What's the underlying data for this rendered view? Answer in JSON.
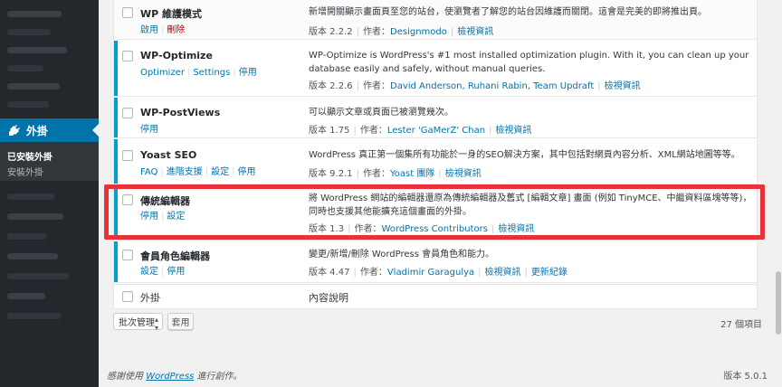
{
  "sidebar": {
    "plugins_menu_label": "外掛",
    "submenu": [
      {
        "label": "已安裝外掛",
        "current": true
      },
      {
        "label": "安裝外掛",
        "current": false
      }
    ]
  },
  "plugins": [
    {
      "name": "WP 維護模式",
      "status": "inactive",
      "actions": [
        {
          "label": "啟用"
        },
        {
          "label": "刪除",
          "danger": true
        }
      ],
      "description": "新增開關顯示畫面頁至您的站台，使瀏覽者了解您的站台因維護而關閉。這會是完美的即將推出頁。",
      "version": "版本 2.2.2",
      "author_prefix": "作者：",
      "authors": "Designmodo",
      "details": "檢視資訊"
    },
    {
      "name": "WP-Optimize",
      "status": "active",
      "actions": [
        {
          "label": "Optimizer"
        },
        {
          "label": "Settings"
        },
        {
          "label": "停用"
        }
      ],
      "description": "WP-Optimize is WordPress's #1 most installed optimization plugin. With it, you can clean up your database easily and safely, without manual queries.",
      "version": "版本 2.2.6",
      "author_prefix": "作者：",
      "authors": "David Anderson, Ruhani Rabin, Team Updraft",
      "details": "檢視資訊"
    },
    {
      "name": "WP-PostViews",
      "status": "active",
      "actions": [
        {
          "label": "停用"
        }
      ],
      "description": "可以顯示文章或頁面已被瀏覽幾次。",
      "version": "版本 1.75",
      "author_prefix": "作者：",
      "authors": "Lester 'GaMerZ' Chan",
      "details": "檢視資訊"
    },
    {
      "name": "Yoast SEO",
      "status": "active",
      "actions": [
        {
          "label": "FAQ"
        },
        {
          "label": "進階支援"
        },
        {
          "label": "設定"
        },
        {
          "label": "停用"
        }
      ],
      "description": "WordPress 真正第一個集所有功能於一身的SEO解決方案，其中包括對網頁內容分析、XML網站地圖等等。",
      "version": "版本 9.2.1",
      "author_prefix": "作者：",
      "authors": "Yoast 團隊",
      "details": "檢視資訊"
    },
    {
      "name": "傳統編輯器",
      "status": "active",
      "actions": [
        {
          "label": "停用"
        },
        {
          "label": "設定"
        }
      ],
      "description": "將 WordPress 網站的編輯器還原為傳統編輯器及舊式 [編輯文章] 畫面 (例如 TinyMCE、中繼資料區塊等等)，同時也支援其他能擴充這個畫面的外掛。",
      "version": "版本 1.3",
      "author_prefix": "作者：",
      "authors": "WordPress Contributors",
      "details": "檢視資訊"
    },
    {
      "name": "會員角色編輯器",
      "status": "active",
      "actions": [
        {
          "label": "設定"
        },
        {
          "label": "停用"
        }
      ],
      "description": "變更/新增/刪除 WordPress 會員角色和能力。",
      "version": "版本 4.47",
      "author_prefix": "作者：",
      "authors": "Vladimir Garagulya",
      "details": "檢視資訊",
      "changelog": "更新紀錄"
    }
  ],
  "table_footer": {
    "col_plugin": "外掛",
    "col_description": "內容說明"
  },
  "bulk": {
    "select_label": "批次管理",
    "apply_label": "套用",
    "count": "27 個項目"
  },
  "footer": {
    "credit_prefix": "感謝使用 ",
    "credit_link": "WordPress",
    "credit_suffix": " 進行創作。",
    "version": "版本 5.0.1"
  },
  "colors": {
    "accent": "#0073aa",
    "active_bar": "#00a0d2",
    "highlight": "#e8323a",
    "danger": "#a00000"
  }
}
